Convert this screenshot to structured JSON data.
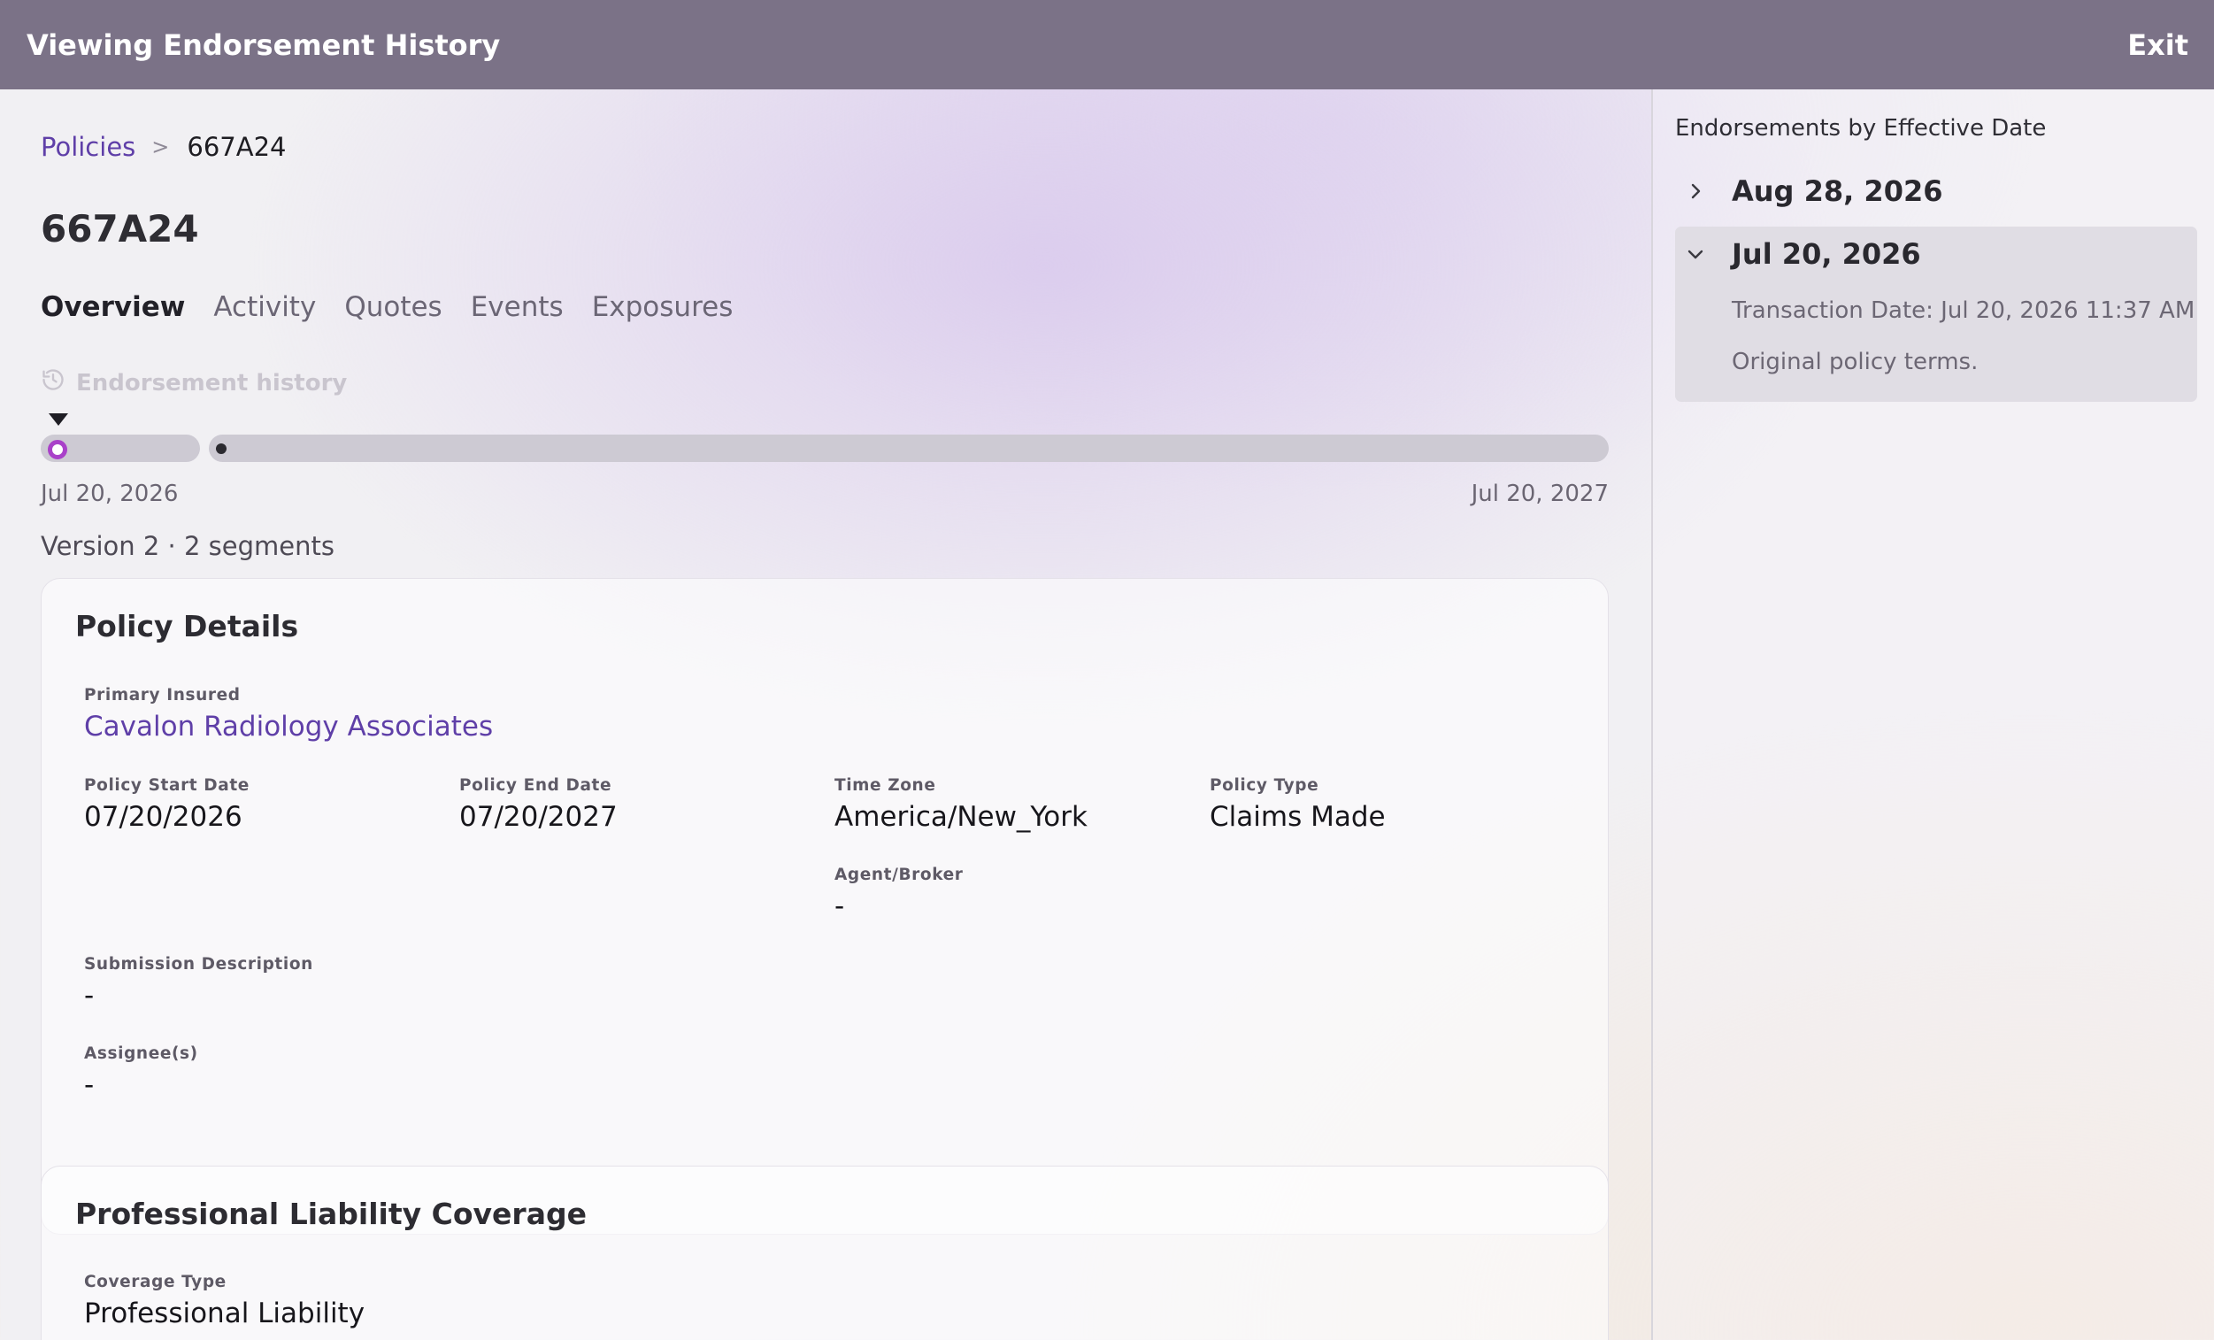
{
  "topbar": {
    "title": "Viewing Endorsement History",
    "exit_label": "Exit"
  },
  "breadcrumb": {
    "parent": "Policies",
    "separator": ">",
    "current": "667A24"
  },
  "page_title": "667A24",
  "tabs": [
    {
      "label": "Overview",
      "active": true
    },
    {
      "label": "Activity",
      "active": false
    },
    {
      "label": "Quotes",
      "active": false
    },
    {
      "label": "Events",
      "active": false
    },
    {
      "label": "Exposures",
      "active": false
    }
  ],
  "endorsement_history_label": "Endorsement history",
  "timeline": {
    "start_date": "Jul 20, 2026",
    "end_date": "Jul 20, 2027",
    "version_label": "Version 2 · 2 segments"
  },
  "policy_details": {
    "title": "Policy Details",
    "primary_insured_label": "Primary Insured",
    "primary_insured_value": "Cavalon Radiology Associates",
    "start_date_label": "Policy Start Date",
    "start_date_value": "07/20/2026",
    "end_date_label": "Policy End Date",
    "end_date_value": "07/20/2027",
    "time_zone_label": "Time Zone",
    "time_zone_value": "America/New_York",
    "policy_type_label": "Policy Type",
    "policy_type_value": "Claims Made",
    "agent_label": "Agent/Broker",
    "agent_value": "-",
    "submission_label": "Submission Description",
    "submission_value": "-",
    "assignees_label": "Assignee(s)",
    "assignees_value": "-"
  },
  "coverage": {
    "title": "Professional Liability Coverage",
    "type_label": "Coverage Type",
    "type_value": "Professional Liability"
  },
  "side_panel": {
    "heading": "Endorsements by Effective Date",
    "endorsements": [
      {
        "date": "Aug 28, 2026",
        "expanded": false
      },
      {
        "date": "Jul 20, 2026",
        "expanded": true,
        "transaction": "Transaction Date: Jul 20, 2026 11:37 AM",
        "note": "Original policy terms."
      }
    ]
  },
  "colors": {
    "topbar": "#7b7287",
    "link": "#5f3fa8",
    "selected_segment_ring": "#a941c9",
    "segment_bar": "#cdcad3"
  }
}
